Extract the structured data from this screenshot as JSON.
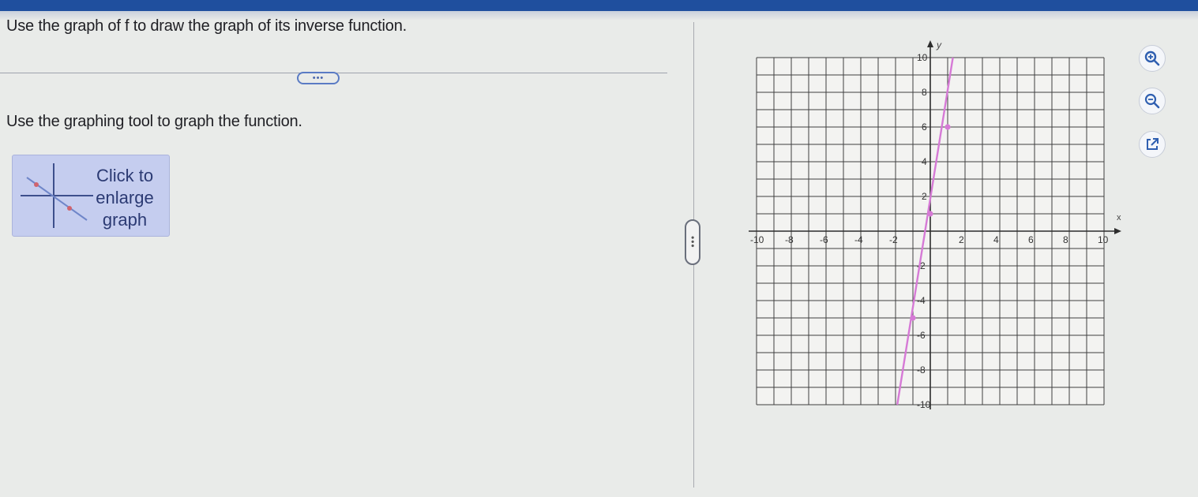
{
  "question": {
    "prompt": "Use the graph of f to draw the graph of its inverse function.",
    "expand_label": "•••"
  },
  "instruction": "Use the graphing tool to graph the function.",
  "enlarge_button": {
    "lines": [
      "Click to",
      "enlarge",
      "graph"
    ]
  },
  "divider_handle": "•••",
  "graph": {
    "x_axis_label": "x",
    "y_axis_label": "y",
    "x_ticks": [
      "-10",
      "-8",
      "-6",
      "-4",
      "-2",
      "2",
      "4",
      "6",
      "8",
      "10"
    ],
    "y_ticks": [
      "10",
      "8",
      "6",
      "4",
      "2",
      "-2",
      "-4",
      "-6",
      "-8",
      "-10"
    ],
    "colors": {
      "line": "#d67ad6",
      "grid": "#3f3f3f",
      "axis": "#2d2d2d"
    }
  },
  "chart_data": {
    "type": "line",
    "xlim": [
      -10,
      10
    ],
    "ylim": [
      -10,
      10
    ],
    "grid": true,
    "series": [
      {
        "x": [
          -1.9,
          1.3
        ],
        "y": [
          -10,
          10
        ],
        "marked_points": [
          [
            -1,
            -5
          ],
          [
            0,
            1
          ],
          [
            1,
            6
          ]
        ]
      }
    ]
  },
  "side_icons": [
    "zoom-in-icon",
    "zoom-out-icon",
    "external-link-icon"
  ]
}
